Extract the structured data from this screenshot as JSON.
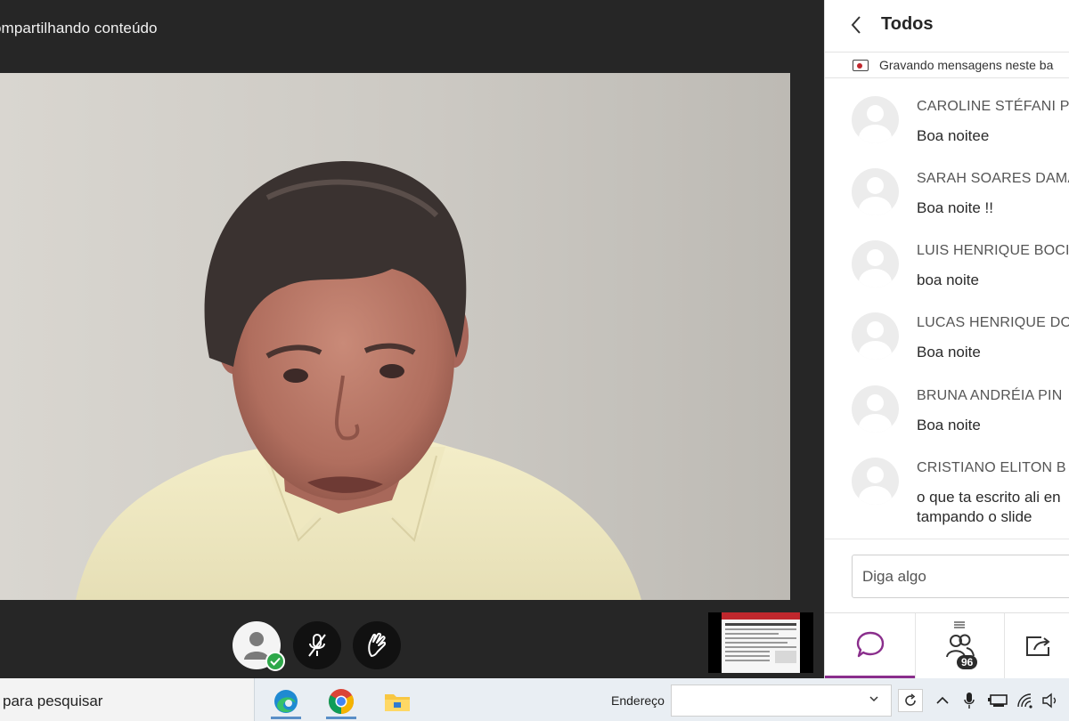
{
  "meeting": {
    "share_status": "ompartilhando conteúdo",
    "participant_count": "96"
  },
  "chat": {
    "title": "Todos",
    "recording_notice": "Gravando mensagens neste ba",
    "input_placeholder": "Diga algo",
    "messages": [
      {
        "name": "CAROLINE STÉFANI P",
        "text": "Boa noitee"
      },
      {
        "name": "SARAH SOARES DAMA",
        "text": "Boa noite !!"
      },
      {
        "name": "LUIS HENRIQUE BOCI",
        "text": "boa noite"
      },
      {
        "name": "LUCAS HENRIQUE DO",
        "text": "Boa noite"
      },
      {
        "name": "BRUNA ANDRÉIA PIN",
        "text": "Boa noite"
      },
      {
        "name": "CRISTIANO ELITON B",
        "text": "o que ta escrito ali en",
        "text2": "tampando o slide"
      }
    ]
  },
  "taskbar": {
    "search_text": "para pesquisar",
    "address_label": "Endereço"
  },
  "colors": {
    "accent_purple": "#8a2e8c",
    "status_green": "#2ea84a",
    "record_red": "#c0272d"
  },
  "icons": [
    "back-chevron-icon",
    "record-icon",
    "user-avatar-icon",
    "mic-off-icon",
    "raise-hand-icon",
    "chat-bubble-icon",
    "participants-icon",
    "share-icon",
    "edge-icon",
    "chrome-icon",
    "file-explorer-icon",
    "refresh-icon",
    "tray-chevron-icon",
    "microphone-icon",
    "network-icon",
    "wifi-icon",
    "volume-icon"
  ]
}
